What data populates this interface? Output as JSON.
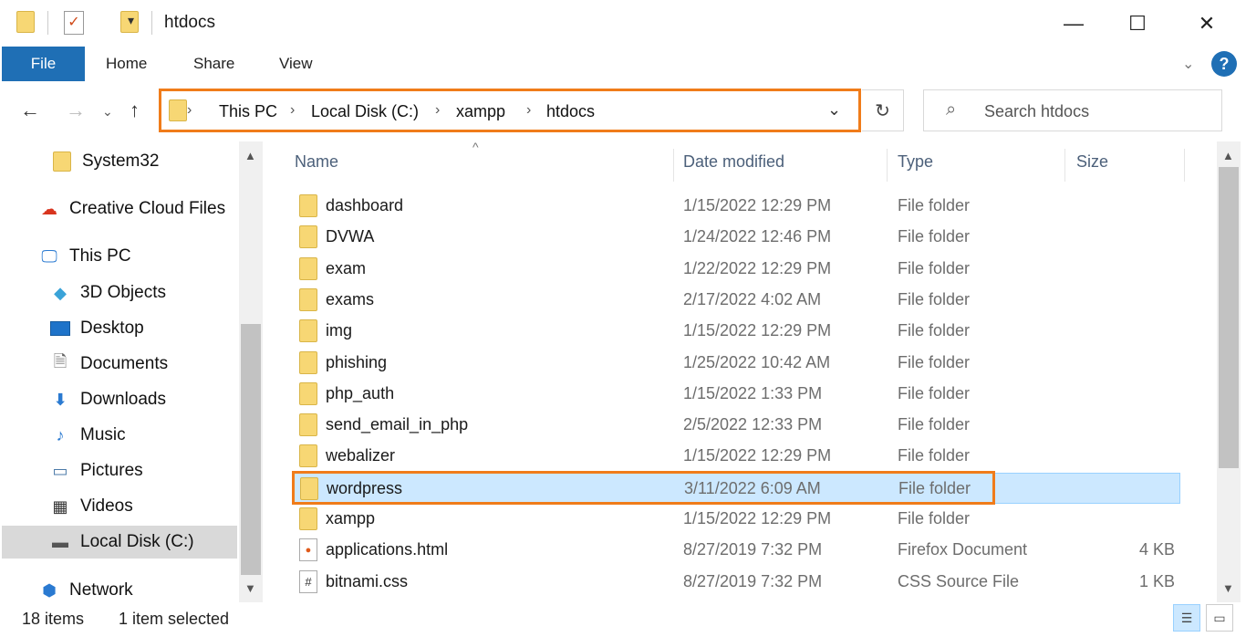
{
  "window": {
    "title": "htdocs",
    "minimize": "—",
    "maximize": "☐",
    "close": "✕"
  },
  "ribbon": {
    "file": "File",
    "home": "Home",
    "share": "Share",
    "view": "View",
    "help": "?"
  },
  "address": {
    "crumbs": [
      "This PC",
      "Local Disk (C:)",
      "xampp",
      "htdocs"
    ],
    "separator": "›"
  },
  "search": {
    "placeholder": "Search htdocs"
  },
  "sidebar": {
    "items": [
      {
        "label": "System32",
        "icon": "folder-icon"
      },
      {
        "label": "Creative Cloud Files",
        "icon": "creative-cloud-icon"
      },
      {
        "label": "This PC",
        "icon": "computer-icon"
      },
      {
        "label": "3D Objects",
        "icon": "cube-icon"
      },
      {
        "label": "Desktop",
        "icon": "desktop-icon"
      },
      {
        "label": "Documents",
        "icon": "document-icon"
      },
      {
        "label": "Downloads",
        "icon": "download-icon"
      },
      {
        "label": "Music",
        "icon": "music-icon"
      },
      {
        "label": "Pictures",
        "icon": "picture-icon"
      },
      {
        "label": "Videos",
        "icon": "video-icon"
      },
      {
        "label": "Local Disk (C:)",
        "icon": "drive-icon"
      },
      {
        "label": "Network",
        "icon": "network-icon"
      }
    ],
    "selected": "Local Disk (C:)"
  },
  "columns": {
    "name": "Name",
    "date": "Date modified",
    "type": "Type",
    "size": "Size"
  },
  "files": [
    {
      "name": "dashboard",
      "date": "1/15/2022 12:29 PM",
      "type": "File folder",
      "size": "",
      "kind": "folder"
    },
    {
      "name": "DVWA",
      "date": "1/24/2022 12:46 PM",
      "type": "File folder",
      "size": "",
      "kind": "folder"
    },
    {
      "name": "exam",
      "date": "1/22/2022 12:29 PM",
      "type": "File folder",
      "size": "",
      "kind": "folder"
    },
    {
      "name": "exams",
      "date": "2/17/2022 4:02 AM",
      "type": "File folder",
      "size": "",
      "kind": "folder"
    },
    {
      "name": "img",
      "date": "1/15/2022 12:29 PM",
      "type": "File folder",
      "size": "",
      "kind": "folder"
    },
    {
      "name": "phishing",
      "date": "1/25/2022 10:42 AM",
      "type": "File folder",
      "size": "",
      "kind": "folder"
    },
    {
      "name": "php_auth",
      "date": "1/15/2022 1:33 PM",
      "type": "File folder",
      "size": "",
      "kind": "folder"
    },
    {
      "name": "send_email_in_php",
      "date": "2/5/2022 12:33 PM",
      "type": "File folder",
      "size": "",
      "kind": "folder"
    },
    {
      "name": "webalizer",
      "date": "1/15/2022 12:29 PM",
      "type": "File folder",
      "size": "",
      "kind": "folder"
    },
    {
      "name": "wordpress",
      "date": "3/11/2022 6:09 AM",
      "type": "File folder",
      "size": "",
      "kind": "folder",
      "selected": true
    },
    {
      "name": "xampp",
      "date": "1/15/2022 12:29 PM",
      "type": "File folder",
      "size": "",
      "kind": "folder"
    },
    {
      "name": "applications.html",
      "date": "8/27/2019 7:32 PM",
      "type": "Firefox Document",
      "size": "4 KB",
      "kind": "html"
    },
    {
      "name": "bitnami.css",
      "date": "8/27/2019 7:32 PM",
      "type": "CSS Source File",
      "size": "1 KB",
      "kind": "css"
    }
  ],
  "status": {
    "count": "18 items",
    "selection": "1 item selected"
  }
}
